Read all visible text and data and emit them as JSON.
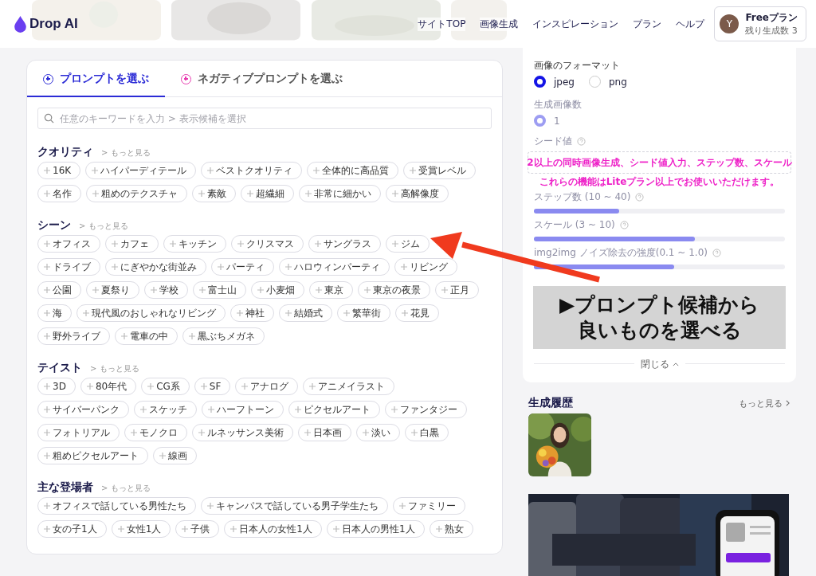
{
  "header": {
    "logo": "Drop AI",
    "nav": [
      {
        "label": "サイトTOP"
      },
      {
        "label": "画像生成"
      },
      {
        "label": "インスピレーション"
      },
      {
        "label": "プラン"
      },
      {
        "label": "ヘルプ"
      }
    ],
    "plan": {
      "avatar": "Y",
      "title": "Freeプラン",
      "remaining": "残り生成数 3"
    }
  },
  "prompt_panel": {
    "tabs": [
      {
        "label": "プロンプトを選ぶ",
        "selected": true,
        "color": "#2b2bd6"
      },
      {
        "label": "ネガティブプロンプトを選ぶ",
        "selected": false,
        "color": "#e83bb0"
      }
    ],
    "search": {
      "placeholder": "任意のキーワードを入力 > 表示候補を選択"
    },
    "categories": [
      {
        "title": "クオリティ",
        "more": "> もっと見る",
        "tags": [
          "16K",
          "ハイパーディテール",
          "ベストクオリティ",
          "全体的に高品質",
          "受賞レベル",
          "名作",
          "粗めのテクスチャ",
          "素敵",
          "超繊細",
          "非常に細かい",
          "高解像度"
        ]
      },
      {
        "title": "シーン",
        "more": "> もっと見る",
        "tags": [
          "オフィス",
          "カフェ",
          "キッチン",
          "クリスマス",
          "サングラス",
          "ジム",
          "ドライブ",
          "にぎやかな街並み",
          "パーティ",
          "ハロウィンパーティ",
          "リビング",
          "公園",
          "夏祭り",
          "学校",
          "富士山",
          "小麦畑",
          "東京",
          "東京の夜景",
          "正月",
          "海",
          "現代風のおしゃれなリビング",
          "神社",
          "結婚式",
          "繁華街",
          "花見",
          "野外ライブ",
          "電車の中",
          "黒ぶちメガネ"
        ]
      },
      {
        "title": "テイスト",
        "more": "> もっと見る",
        "tags": [
          "3D",
          "80年代",
          "CG系",
          "SF",
          "アナログ",
          "アニメイラスト",
          "サイバーパンク",
          "スケッチ",
          "ハーフトーン",
          "ピクセルアート",
          "ファンタジー",
          "フォトリアル",
          "モノクロ",
          "ルネッサンス美術",
          "日本画",
          "淡い",
          "白黒",
          "粗めピクセルアート",
          "線画"
        ]
      },
      {
        "title": "主な登場者",
        "more": "> もっと見る",
        "tags": [
          "オフィスで話している男性たち",
          "キャンパスで話している男子学生たち",
          "ファミリー",
          "女の子1人",
          "女性1人",
          "子供",
          "日本人の女性1人",
          "日本人の男性1人",
          "熟女"
        ]
      }
    ]
  },
  "settings": {
    "format": {
      "label": "画像のフォーマット",
      "options": [
        {
          "label": "jpeg",
          "selected": true
        },
        {
          "label": "png",
          "selected": false
        }
      ]
    },
    "locked": true,
    "count": {
      "label": "生成画像数",
      "options": [
        {
          "label": "1",
          "selected": true
        }
      ]
    },
    "seed": {
      "label": "シード値"
    },
    "notice": [
      "2以上の同時画像生成、シード値入力、ステップ数、スケール",
      "これらの機能はLiteプラン以上でお使いいただけます。"
    ],
    "sliders": [
      {
        "label": "ステップ数 (10 ~ 40)",
        "level": 0.34
      },
      {
        "label": "スケール (3 ~ 10)",
        "level": 0.64
      },
      {
        "label": "img2img ノイズ除去の強度(0.1 ~ 1.0)",
        "level": 0.56
      }
    ],
    "close": "閉じる"
  },
  "annotation": {
    "lines": [
      "▶プロンプト候補から",
      "良いものを選べる"
    ]
  },
  "history": {
    "title": "生成履歴",
    "more": "もっと見る"
  }
}
